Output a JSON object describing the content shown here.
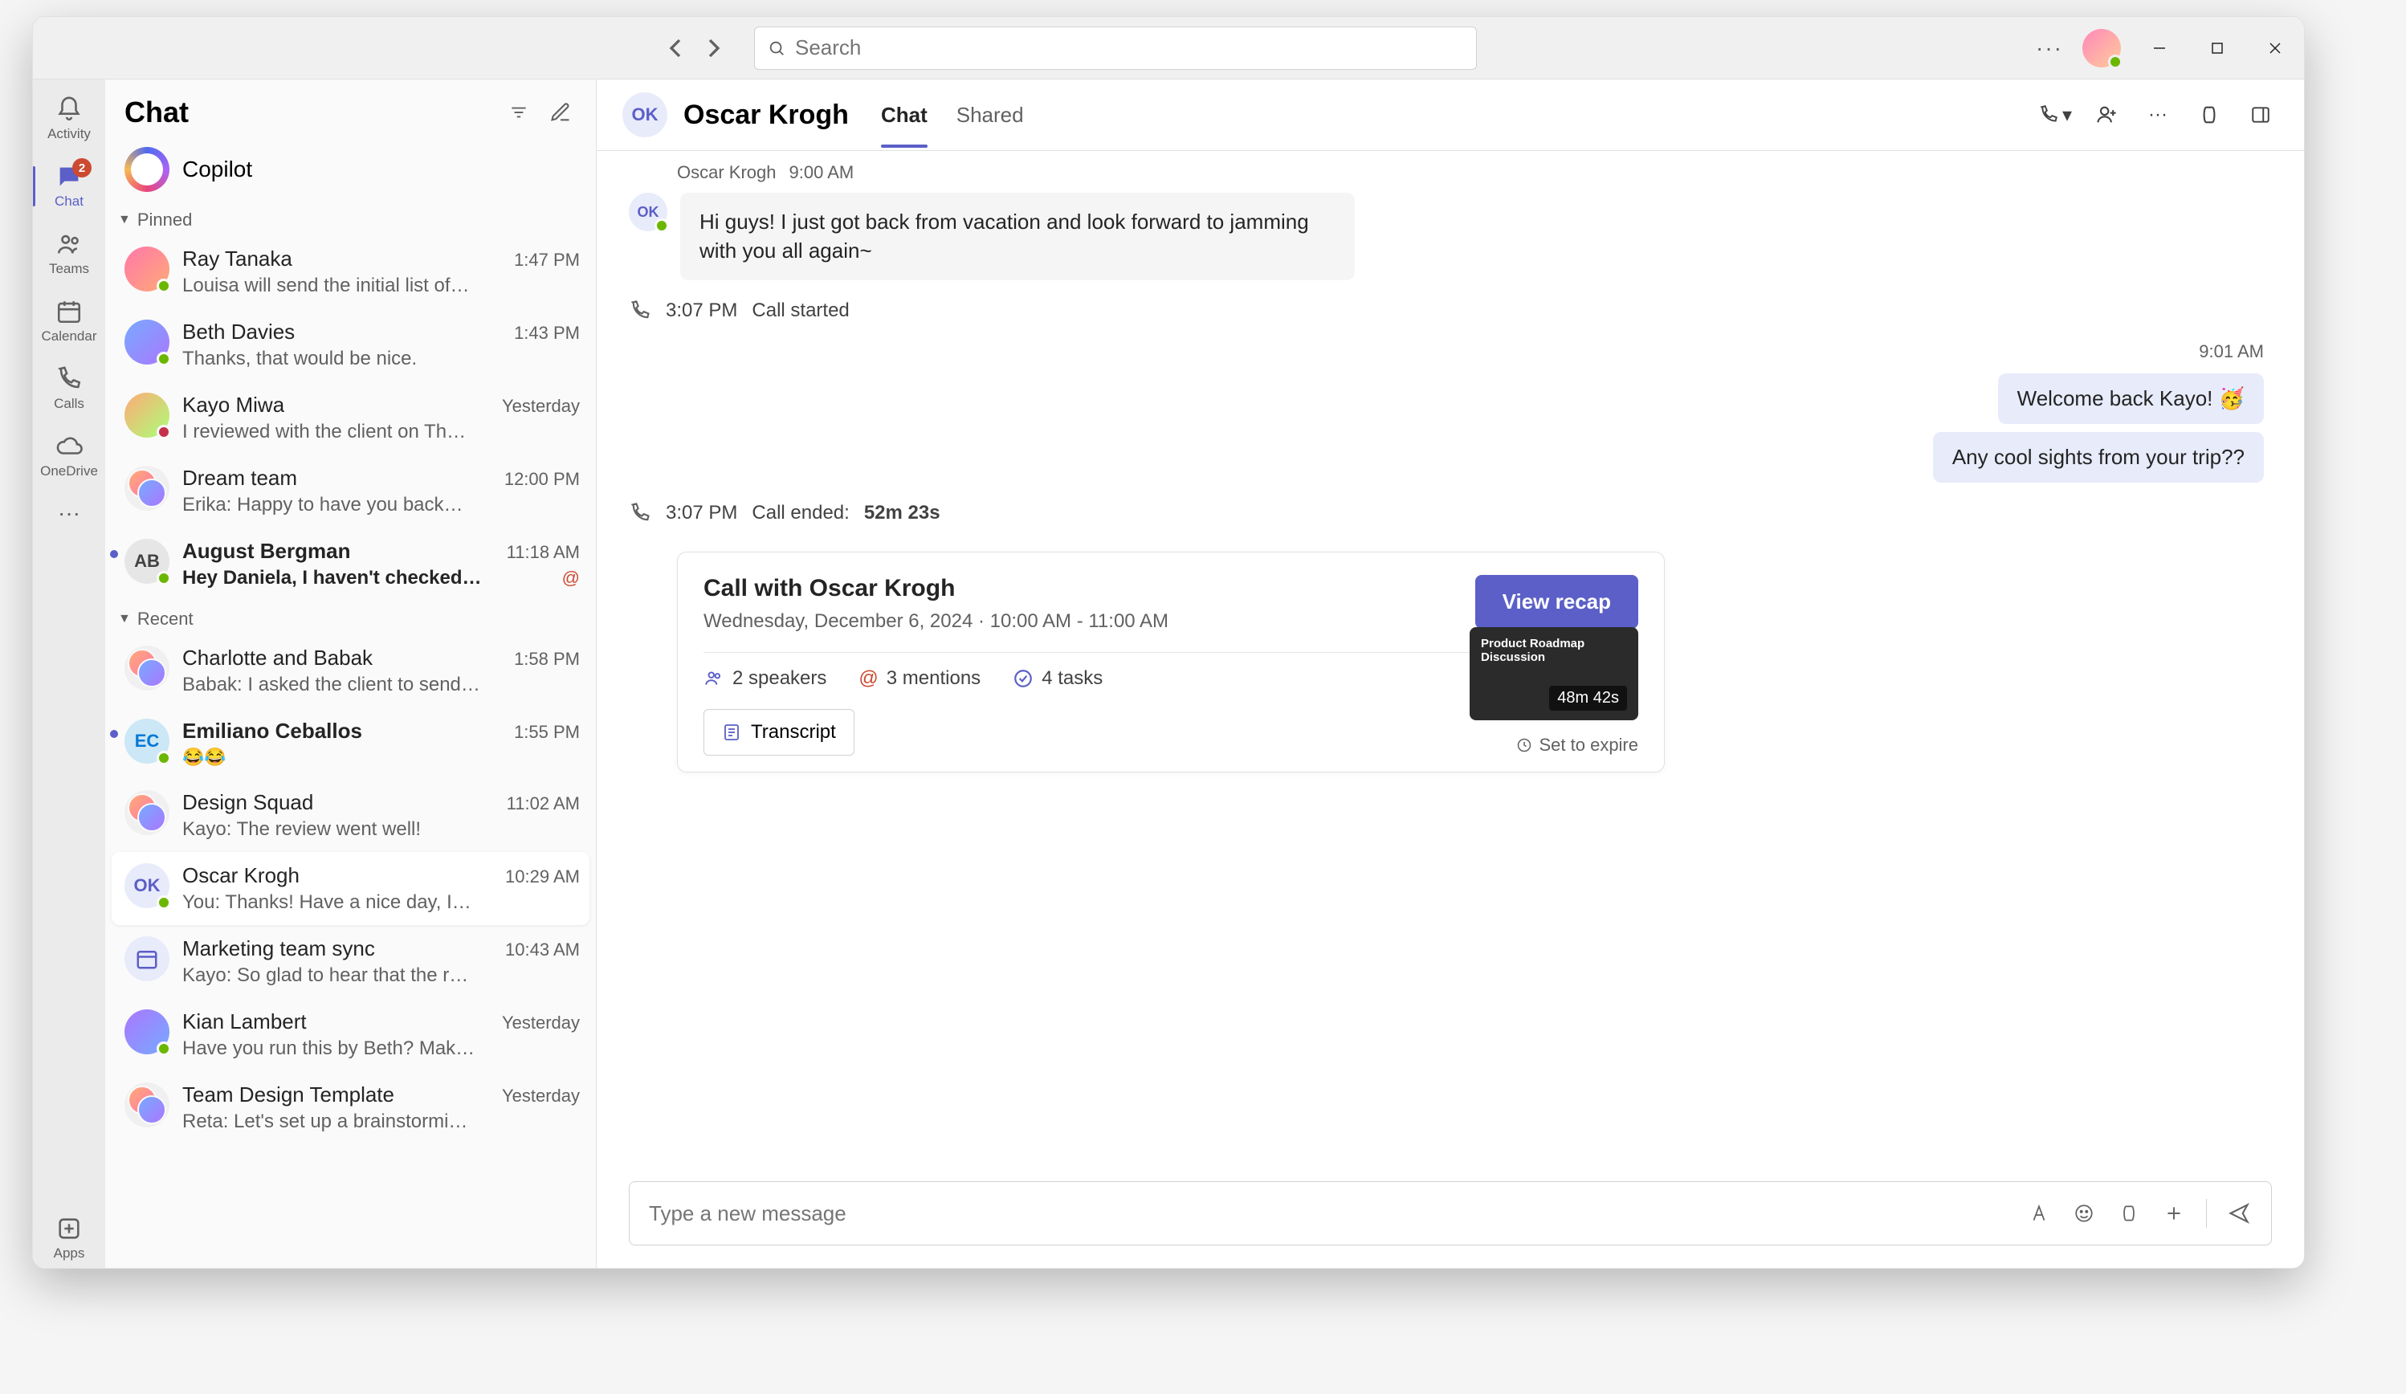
{
  "search": {
    "placeholder": "Search"
  },
  "rail": {
    "activity": "Activity",
    "chat": "Chat",
    "chat_badge": "2",
    "teams": "Teams",
    "calendar": "Calendar",
    "calls": "Calls",
    "onedrive": "OneDrive",
    "apps": "Apps"
  },
  "chatlist": {
    "title": "Chat",
    "copilot": "Copilot",
    "pinned": "Pinned",
    "recent": "Recent",
    "items": [
      {
        "name": "Ray Tanaka",
        "time": "1:47 PM",
        "preview": "Louisa will send the initial list of…"
      },
      {
        "name": "Beth Davies",
        "time": "1:43 PM",
        "preview": "Thanks, that would be nice."
      },
      {
        "name": "Kayo Miwa",
        "time": "Yesterday",
        "preview": "I reviewed with the client on Th…"
      },
      {
        "name": "Dream team",
        "time": "12:00 PM",
        "preview": "Erika: Happy to have you back…"
      },
      {
        "name": "August Bergman",
        "time": "11:18 AM",
        "preview": "Hey Daniela, I haven't checked…"
      },
      {
        "name": "Charlotte and Babak",
        "time": "1:58 PM",
        "preview": "Babak: I asked the client to send…"
      },
      {
        "name": "Emiliano Ceballos",
        "time": "1:55 PM",
        "preview": "😂😂"
      },
      {
        "name": "Design Squad",
        "time": "11:02 AM",
        "preview": "Kayo: The review went well!"
      },
      {
        "name": "Oscar Krogh",
        "time": "10:29 AM",
        "preview": "You: Thanks! Have a nice day, I…"
      },
      {
        "name": "Marketing team sync",
        "time": "10:43 AM",
        "preview": "Kayo: So glad to hear that the r…"
      },
      {
        "name": "Kian Lambert",
        "time": "Yesterday",
        "preview": "Have you run this by Beth? Mak…"
      },
      {
        "name": "Team Design Template",
        "time": "Yesterday",
        "preview": "Reta: Let's set up a brainstormi…"
      }
    ]
  },
  "conv": {
    "name": "Oscar Krogh",
    "avatar": "OK",
    "tabs": {
      "chat": "Chat",
      "shared": "Shared"
    },
    "header_msg": {
      "author": "Oscar Krogh",
      "time": "9:00 AM"
    },
    "msg1": "Hi guys! I just got back from vacation and look forward to jamming with you all again~",
    "reply_time": "9:01 AM",
    "reply1": "Welcome back Kayo! 🥳",
    "reply2": "Any cool sights from your trip??",
    "call_start": {
      "time": "3:07 PM",
      "text": "Call started"
    },
    "call_end": {
      "time": "3:07 PM",
      "text": "Call ended:",
      "duration": "52m 23s"
    },
    "recap": {
      "title": "Call with Oscar Krogh",
      "subtitle": "Wednesday, December 6, 2024 · 10:00 AM - 11:00 AM",
      "button": "View recap",
      "speakers": "2 speakers",
      "mentions": "3 mentions",
      "tasks": "4 tasks",
      "transcript": "Transcript",
      "thumb_title": "Product Roadmap Discussion",
      "thumb_dur": "48m 42s",
      "expire": "Set to expire"
    },
    "composer_placeholder": "Type a new message"
  }
}
